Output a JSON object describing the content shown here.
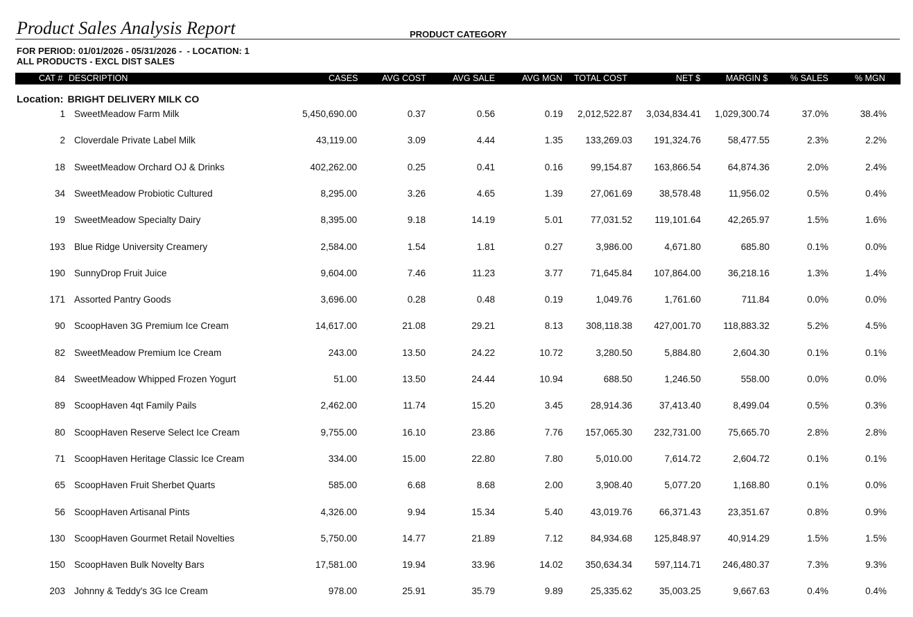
{
  "report": {
    "title": "Product Sales Analysis Report",
    "category_header": "PRODUCT CATEGORY",
    "period_line1": "FOR PERIOD: 01/01/2026 - 05/31/2026 -  - LOCATION: 1",
    "period_line2": "ALL PRODUCTS - EXCL DIST SALES"
  },
  "columns": [
    "CAT #",
    "DESCRIPTION",
    "CASES",
    "AVG COST",
    "AVG SALE",
    "AVG MGN",
    "TOTAL COST",
    "NET $",
    "MARGIN $",
    "% SALES",
    "% MGN"
  ],
  "location": {
    "label": "Location:",
    "name": "BRIGHT DELIVERY MILK CO"
  },
  "rows": [
    {
      "cat": "1",
      "desc": "SweetMeadow Farm Milk",
      "cases": "5,450,690.00",
      "avg_cost": "0.37",
      "avg_sale": "0.56",
      "avg_mgn": "0.19",
      "total_cost": "2,012,522.87",
      "net": "3,034,834.41",
      "margin": "1,029,300.74",
      "pct_sales": "37.0%",
      "pct_mgn": "38.4%"
    },
    {
      "cat": "2",
      "desc": "Cloverdale Private Label Milk",
      "cases": "43,119.00",
      "avg_cost": "3.09",
      "avg_sale": "4.44",
      "avg_mgn": "1.35",
      "total_cost": "133,269.03",
      "net": "191,324.76",
      "margin": "58,477.55",
      "pct_sales": "2.3%",
      "pct_mgn": "2.2%"
    },
    {
      "cat": "18",
      "desc": "SweetMeadow Orchard OJ & Drinks",
      "cases": "402,262.00",
      "avg_cost": "0.25",
      "avg_sale": "0.41",
      "avg_mgn": "0.16",
      "total_cost": "99,154.87",
      "net": "163,866.54",
      "margin": "64,874.36",
      "pct_sales": "2.0%",
      "pct_mgn": "2.4%"
    },
    {
      "cat": "34",
      "desc": "SweetMeadow Probiotic Cultured",
      "cases": "8,295.00",
      "avg_cost": "3.26",
      "avg_sale": "4.65",
      "avg_mgn": "1.39",
      "total_cost": "27,061.69",
      "net": "38,578.48",
      "margin": "11,956.02",
      "pct_sales": "0.5%",
      "pct_mgn": "0.4%"
    },
    {
      "cat": "19",
      "desc": "SweetMeadow Specialty Dairy",
      "cases": "8,395.00",
      "avg_cost": "9.18",
      "avg_sale": "14.19",
      "avg_mgn": "5.01",
      "total_cost": "77,031.52",
      "net": "119,101.64",
      "margin": "42,265.97",
      "pct_sales": "1.5%",
      "pct_mgn": "1.6%"
    },
    {
      "cat": "193",
      "desc": "Blue Ridge University Creamery",
      "cases": "2,584.00",
      "avg_cost": "1.54",
      "avg_sale": "1.81",
      "avg_mgn": "0.27",
      "total_cost": "3,986.00",
      "net": "4,671.80",
      "margin": "685.80",
      "pct_sales": "0.1%",
      "pct_mgn": "0.0%"
    },
    {
      "cat": "190",
      "desc": "SunnyDrop Fruit Juice",
      "cases": "9,604.00",
      "avg_cost": "7.46",
      "avg_sale": "11.23",
      "avg_mgn": "3.77",
      "total_cost": "71,645.84",
      "net": "107,864.00",
      "margin": "36,218.16",
      "pct_sales": "1.3%",
      "pct_mgn": "1.4%"
    },
    {
      "cat": "171",
      "desc": "Assorted Pantry Goods",
      "cases": "3,696.00",
      "avg_cost": "0.28",
      "avg_sale": "0.48",
      "avg_mgn": "0.19",
      "total_cost": "1,049.76",
      "net": "1,761.60",
      "margin": "711.84",
      "pct_sales": "0.0%",
      "pct_mgn": "0.0%"
    },
    {
      "cat": "90",
      "desc": "ScoopHaven 3G Premium Ice Cream",
      "cases": "14,617.00",
      "avg_cost": "21.08",
      "avg_sale": "29.21",
      "avg_mgn": "8.13",
      "total_cost": "308,118.38",
      "net": "427,001.70",
      "margin": "118,883.32",
      "pct_sales": "5.2%",
      "pct_mgn": "4.5%"
    },
    {
      "cat": "82",
      "desc": "SweetMeadow Premium Ice Cream",
      "cases": "243.00",
      "avg_cost": "13.50",
      "avg_sale": "24.22",
      "avg_mgn": "10.72",
      "total_cost": "3,280.50",
      "net": "5,884.80",
      "margin": "2,604.30",
      "pct_sales": "0.1%",
      "pct_mgn": "0.1%"
    },
    {
      "cat": "84",
      "desc": "SweetMeadow Whipped Frozen Yogurt",
      "cases": "51.00",
      "avg_cost": "13.50",
      "avg_sale": "24.44",
      "avg_mgn": "10.94",
      "total_cost": "688.50",
      "net": "1,246.50",
      "margin": "558.00",
      "pct_sales": "0.0%",
      "pct_mgn": "0.0%"
    },
    {
      "cat": "89",
      "desc": "ScoopHaven 4qt Family Pails",
      "cases": "2,462.00",
      "avg_cost": "11.74",
      "avg_sale": "15.20",
      "avg_mgn": "3.45",
      "total_cost": "28,914.36",
      "net": "37,413.40",
      "margin": "8,499.04",
      "pct_sales": "0.5%",
      "pct_mgn": "0.3%"
    },
    {
      "cat": "80",
      "desc": "ScoopHaven Reserve Select Ice Cream",
      "cases": "9,755.00",
      "avg_cost": "16.10",
      "avg_sale": "23.86",
      "avg_mgn": "7.76",
      "total_cost": "157,065.30",
      "net": "232,731.00",
      "margin": "75,665.70",
      "pct_sales": "2.8%",
      "pct_mgn": "2.8%"
    },
    {
      "cat": "71",
      "desc": "ScoopHaven Heritage Classic Ice Cream",
      "cases": "334.00",
      "avg_cost": "15.00",
      "avg_sale": "22.80",
      "avg_mgn": "7.80",
      "total_cost": "5,010.00",
      "net": "7,614.72",
      "margin": "2,604.72",
      "pct_sales": "0.1%",
      "pct_mgn": "0.1%"
    },
    {
      "cat": "65",
      "desc": "ScoopHaven Fruit Sherbet Quarts",
      "cases": "585.00",
      "avg_cost": "6.68",
      "avg_sale": "8.68",
      "avg_mgn": "2.00",
      "total_cost": "3,908.40",
      "net": "5,077.20",
      "margin": "1,168.80",
      "pct_sales": "0.1%",
      "pct_mgn": "0.0%"
    },
    {
      "cat": "56",
      "desc": "ScoopHaven Artisanal Pints",
      "cases": "4,326.00",
      "avg_cost": "9.94",
      "avg_sale": "15.34",
      "avg_mgn": "5.40",
      "total_cost": "43,019.76",
      "net": "66,371.43",
      "margin": "23,351.67",
      "pct_sales": "0.8%",
      "pct_mgn": "0.9%"
    },
    {
      "cat": "130",
      "desc": "ScoopHaven Gourmet Retail Novelties",
      "cases": "5,750.00",
      "avg_cost": "14.77",
      "avg_sale": "21.89",
      "avg_mgn": "7.12",
      "total_cost": "84,934.68",
      "net": "125,848.97",
      "margin": "40,914.29",
      "pct_sales": "1.5%",
      "pct_mgn": "1.5%"
    },
    {
      "cat": "150",
      "desc": "ScoopHaven Bulk Novelty Bars",
      "cases": "17,581.00",
      "avg_cost": "19.94",
      "avg_sale": "33.96",
      "avg_mgn": "14.02",
      "total_cost": "350,634.34",
      "net": "597,114.71",
      "margin": "246,480.37",
      "pct_sales": "7.3%",
      "pct_mgn": "9.3%"
    },
    {
      "cat": "203",
      "desc": "Johnny & Teddy's 3G Ice Cream",
      "cases": "978.00",
      "avg_cost": "25.91",
      "avg_sale": "35.79",
      "avg_mgn": "9.89",
      "total_cost": "25,335.62",
      "net": "35,003.25",
      "margin": "9,667.63",
      "pct_sales": "0.4%",
      "pct_mgn": "0.4%"
    }
  ]
}
